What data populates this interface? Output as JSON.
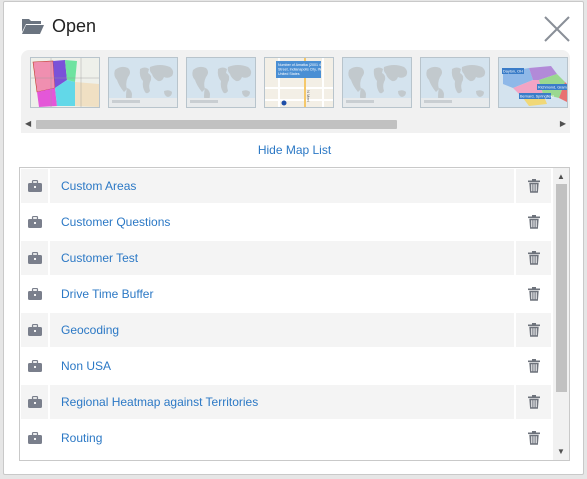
{
  "dialog": {
    "title": "Open",
    "hide_map_list_label": "Hide Map List"
  },
  "thumbnails": [
    {
      "kind": "territory-map"
    },
    {
      "kind": "world-map"
    },
    {
      "kind": "world-map"
    },
    {
      "kind": "street-map",
      "callout_lines": [
        "Number of Amatka (2001 4",
        "Street, Indianapolis City, IN",
        "United States"
      ],
      "road_label": "N Meri"
    },
    {
      "kind": "world-map"
    },
    {
      "kind": "world-map"
    },
    {
      "kind": "usa-map",
      "callout_lines": [
        "Dayton, OH",
        "Richmond, Grams",
        "Bernard, Springfield"
      ]
    }
  ],
  "maps": [
    {
      "name": "Custom Areas"
    },
    {
      "name": "Customer Questions"
    },
    {
      "name": "Customer Test"
    },
    {
      "name": "Drive Time Buffer"
    },
    {
      "name": "Geocoding"
    },
    {
      "name": "Non USA"
    },
    {
      "name": "Regional Heatmap against Territories"
    },
    {
      "name": "Routing"
    }
  ],
  "icons": {
    "title": "folder-open-icon",
    "close": "close-icon",
    "row": "briefcase-icon",
    "delete": "trash-icon"
  },
  "colors": {
    "link": "#2b78c5",
    "row_alt": "#f4f4f4",
    "icon_gray": "#7a7f8c"
  }
}
